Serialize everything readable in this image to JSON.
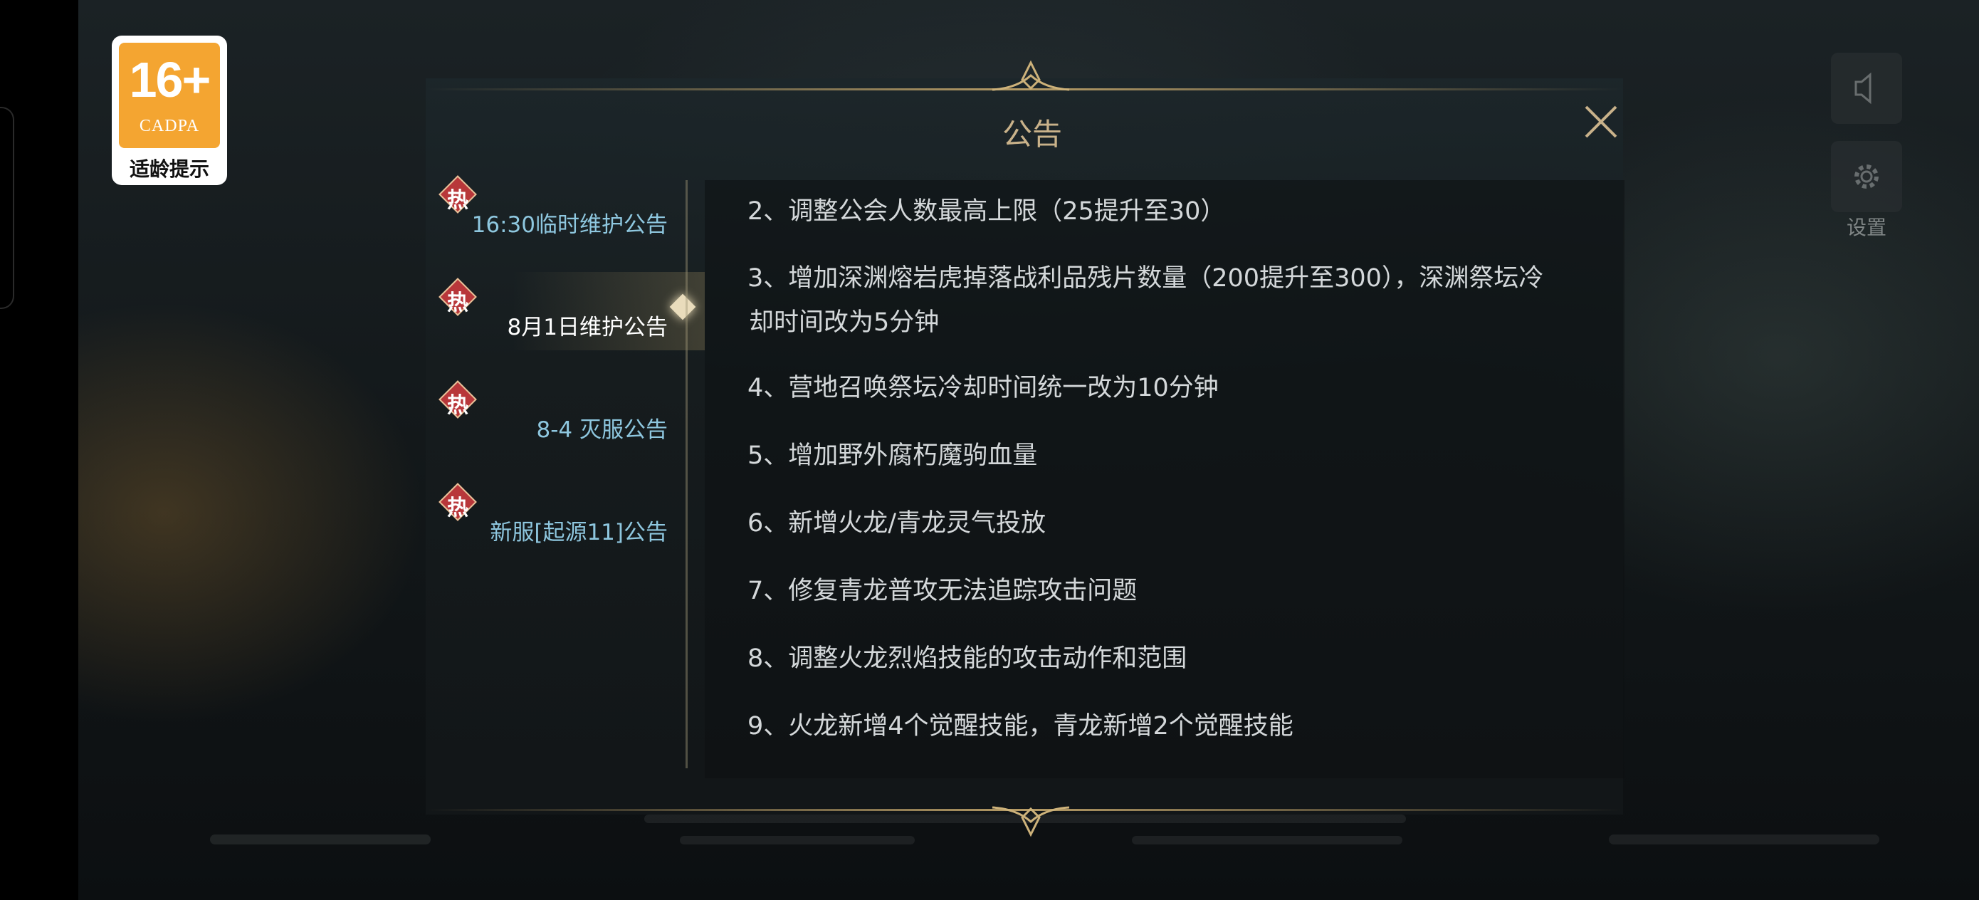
{
  "age_rating": {
    "number": "16+",
    "org": "CADPA",
    "tip": "适龄提示"
  },
  "side_controls": {
    "settings_label": "设置"
  },
  "dialog": {
    "title": "公告"
  },
  "tabs": [
    {
      "hot": "热",
      "label": "16:30临时维护公告"
    },
    {
      "hot": "热",
      "label": "8月1日维护公告"
    },
    {
      "hot": "热",
      "label": "8-4 灭服公告"
    },
    {
      "hot": "热",
      "label": "新服[起源11]公告"
    }
  ],
  "items": [
    "2、调整公会人数最高上限（25提升至30）",
    "3、增加深渊熔岩虎掉落战利品残片数量（200提升至300），深渊祭坛冷",
    "却时间改为5分钟",
    "4、营地召唤祭坛冷却时间统一改为10分钟",
    "5、增加野外腐朽魔驹血量",
    "6、新增火龙/青龙灵气投放",
    "7、修复青龙普攻无法追踪攻击问题",
    "8、调整火龙烈焰技能的攻击动作和范围",
    "9、火龙新增4个觉醒技能，青龙新增2个觉醒技能"
  ]
}
